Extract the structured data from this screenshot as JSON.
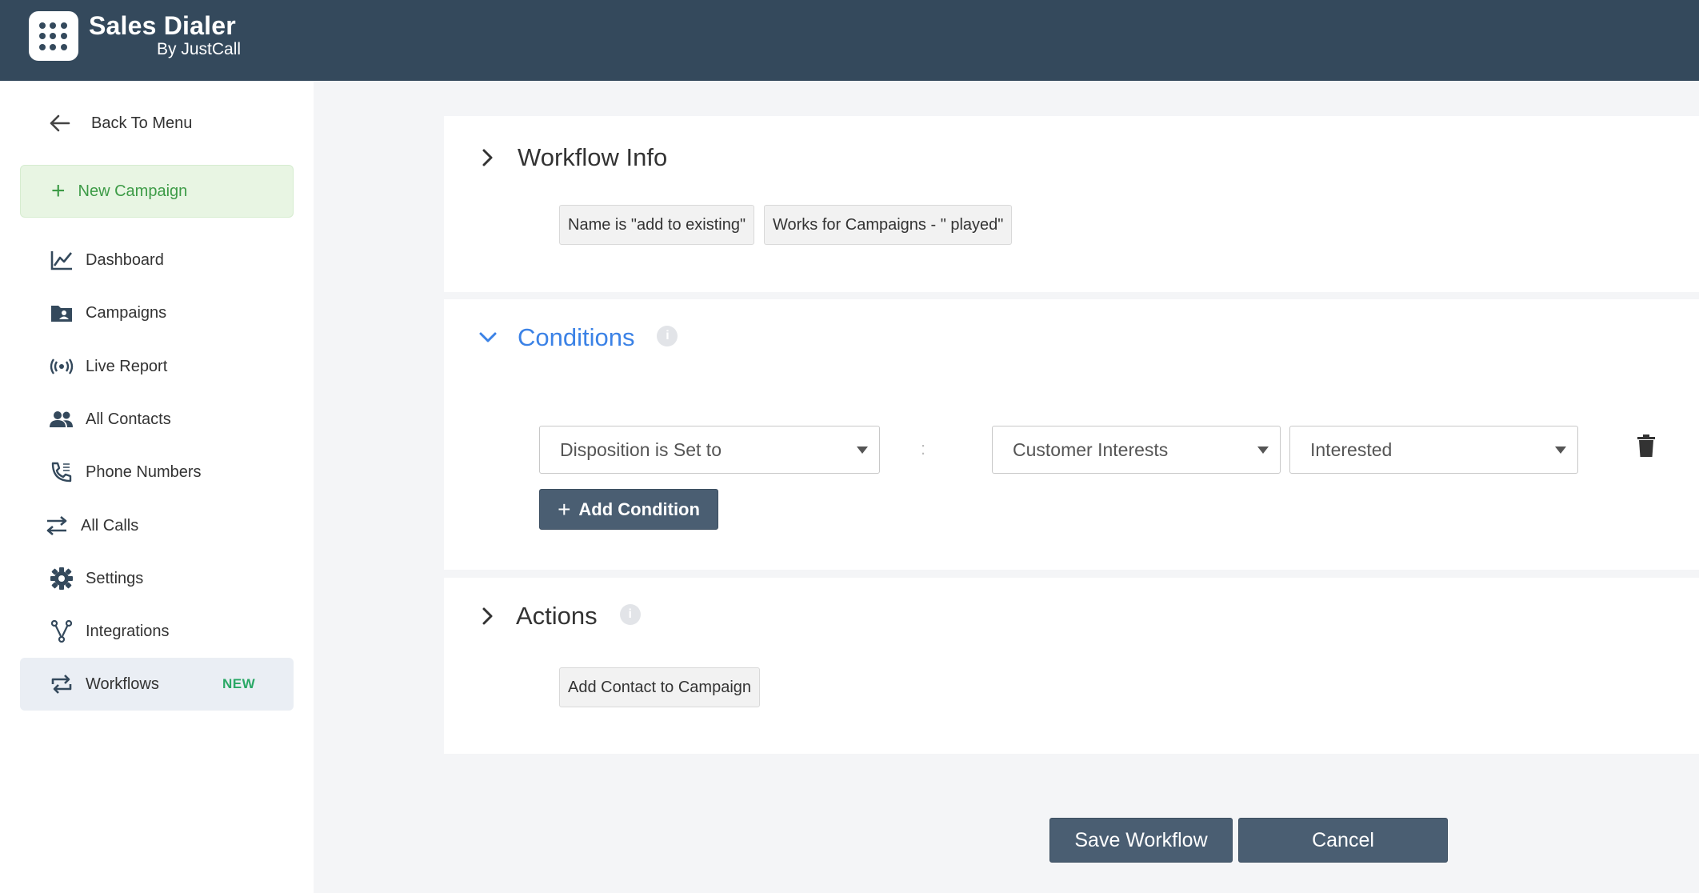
{
  "brand": {
    "title": "Sales Dialer",
    "subtitle": "By JustCall"
  },
  "sidebar": {
    "back_label": "Back To Menu",
    "new_campaign_label": "New Campaign",
    "items": [
      {
        "label": "Dashboard",
        "icon": "chart-line-icon"
      },
      {
        "label": "Campaigns",
        "icon": "folder-contact-icon"
      },
      {
        "label": "Live Report",
        "icon": "broadcast-icon"
      },
      {
        "label": "All Contacts",
        "icon": "people-icon"
      },
      {
        "label": "Phone Numbers",
        "icon": "phone-icon"
      },
      {
        "label": "All Calls",
        "icon": "swap-arrows-icon"
      },
      {
        "label": "Settings",
        "icon": "gear-icon"
      },
      {
        "label": "Integrations",
        "icon": "integration-icon"
      },
      {
        "label": "Workflows",
        "icon": "repeat-icon",
        "badge": "NEW",
        "active": true
      }
    ]
  },
  "workflow_info": {
    "title": "Workflow Info",
    "chips": [
      "Name is \"add to existing\"",
      "Works for Campaigns - \" played\""
    ]
  },
  "conditions": {
    "title": "Conditions",
    "info": "i",
    "field_value": "Disposition is Set to",
    "separator": ":",
    "category_value": "Customer Interests",
    "option_value": "Interested",
    "add_label": "Add Condition"
  },
  "actions": {
    "title": "Actions",
    "info": "i",
    "chips": [
      "Add Contact to Campaign"
    ]
  },
  "footer": {
    "save_label": "Save Workflow",
    "cancel_label": "Cancel"
  },
  "colors": {
    "topbar": "#34495c",
    "accent_blue": "#3b82e6",
    "new_green": "#3d9b47",
    "button_dark": "#4a5e72"
  }
}
